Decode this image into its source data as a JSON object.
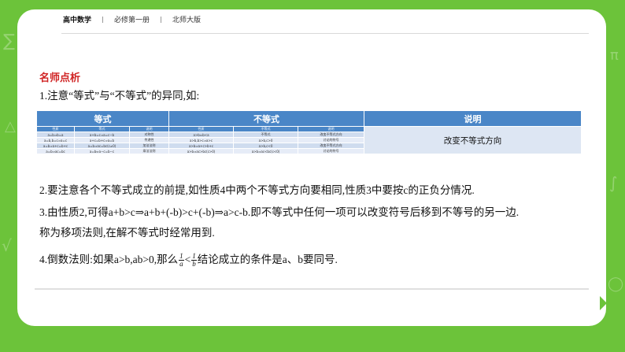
{
  "header": {
    "left": "高中数学",
    "middle": "必修第一册",
    "right": "北师大版"
  },
  "section_title": "名师点析",
  "p1": "1.注意“等式”与“不等式”的异同,如:",
  "table": {
    "groups": [
      "等式",
      "不等式",
      "说明"
    ],
    "sub_headers": [
      "性质",
      "等式",
      "说明",
      "性质",
      "不等式",
      "说明"
    ],
    "rows": [
      [
        "a=b⇒b=a",
        "a+b=c⇒a=c−b",
        "对称性",
        "a>b⇔b<a",
        "不等式",
        "改变不等式方向"
      ],
      [
        "a=b,b=c⇒a=c",
        "a+c=b+c⇒a=b",
        "传递性",
        "a>b,b>c⇒a>c",
        "a>b,c>0",
        "讨论的符号"
      ],
      [
        "a=b⇒a+c=b+c",
        "a=b⇒ac=bc(c≠0)",
        "加法法则",
        "a>b⇒a+c>b+c",
        "a>b,c<0",
        "改变不等式方向"
      ],
      [
        "a=b⇒ac=bc",
        "a=b⇔a−c=b−c",
        "乘法法则",
        "a>b⇒ac>bc(c>0)",
        "a>b⇒ac<bc(c<0)",
        "讨论的符号"
      ]
    ],
    "note": "改变不等式方向"
  },
  "p2": "2.要注意各个不等式成立的前提,如性质4中两个不等式方向要相同,性质3中要按c的正负分情况.",
  "p3_part1": "3.由性质2,可得a+b>c⇒a+b+(-b)>c+(-b)⇒a>c-b.即不等式中任何一项可以改变符号后移到不等号的另一边.",
  "p3_part2": "称为移项法则,在解不等式时经常用到.",
  "p4_pre": "4.倒数法则:如果a>b,ab>0,那么",
  "p4_frac1_num": "1",
  "p4_frac1_den": "a",
  "p4_lt": "<",
  "p4_frac2_num": "1",
  "p4_frac2_den": "b",
  "p4_post": "结论成立的条件是a、b要同号.",
  "colors": {
    "background": "#6cc33a",
    "accent_red": "#d02424",
    "table_header": "#4a86c7"
  }
}
